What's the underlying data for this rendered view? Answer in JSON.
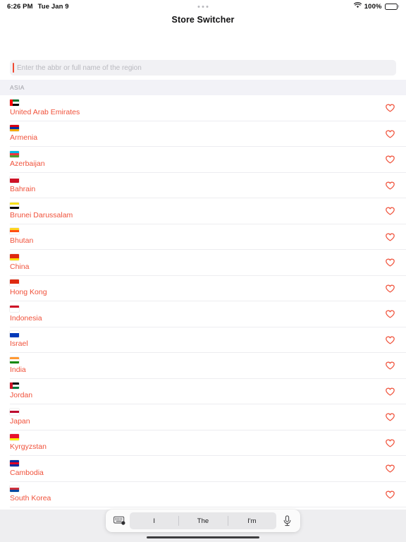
{
  "status_bar": {
    "time": "6:26 PM",
    "date": "Tue Jan 9",
    "battery_percent": "100%",
    "wifi_icon": "wifi-icon",
    "battery_icon": "battery-full-icon"
  },
  "nav": {
    "title": "Store Switcher",
    "multitask_icon": "multitasking-dots-icon"
  },
  "search": {
    "placeholder": "Enter the abbr or full name of the region",
    "value": "",
    "caret_color": "#f04a33"
  },
  "list": {
    "section_title": "ASIA",
    "accent_color": "#f0513a",
    "favorite_icon": "heart-outline-icon",
    "rows": [
      {
        "flag": "🇦🇪",
        "colors": [
          "#00732f",
          "#ffffff",
          "#000000"
        ],
        "hoist": "#ff0000",
        "name": "United Arab Emirates"
      },
      {
        "flag": "🇦🇲",
        "colors": [
          "#d90012",
          "#0033a0",
          "#f2a800"
        ],
        "hoist": "",
        "name": "Armenia"
      },
      {
        "flag": "🇦🇿",
        "colors": [
          "#00b5e2",
          "#ef3340",
          "#509e2f"
        ],
        "hoist": "",
        "name": "Azerbaijan"
      },
      {
        "flag": "🇧🇭",
        "colors": [
          "#ffffff",
          "#ce1126",
          "#ce1126"
        ],
        "hoist": "",
        "name": "Bahrain"
      },
      {
        "flag": "🇧🇳",
        "colors": [
          "#f7e017",
          "#ffffff",
          "#000000"
        ],
        "hoist": "",
        "name": "Brunei Darussalam"
      },
      {
        "flag": "🇧🇹",
        "colors": [
          "#ffd520",
          "#ff4e12",
          "#ffffff"
        ],
        "hoist": "",
        "name": "Bhutan"
      },
      {
        "flag": "🇨🇳",
        "colors": [
          "#de2910",
          "#de2910",
          "#ffde00"
        ],
        "hoist": "",
        "name": "China"
      },
      {
        "flag": "🇭🇰",
        "colors": [
          "#de2910",
          "#de2910",
          "#ffffff"
        ],
        "hoist": "",
        "name": "Hong Kong"
      },
      {
        "flag": "🇮🇩",
        "colors": [
          "#ce1126",
          "#ffffff",
          "#ffffff"
        ],
        "hoist": "",
        "name": "Indonesia"
      },
      {
        "flag": "🇮🇱",
        "colors": [
          "#ffffff",
          "#0038b8",
          "#0038b8"
        ],
        "hoist": "",
        "name": "Israel"
      },
      {
        "flag": "🇮🇳",
        "colors": [
          "#ff9933",
          "#ffffff",
          "#138808"
        ],
        "hoist": "",
        "name": "India"
      },
      {
        "flag": "🇯🇴",
        "colors": [
          "#000000",
          "#ffffff",
          "#007a3d"
        ],
        "hoist": "#ce1126",
        "name": "Jordan"
      },
      {
        "flag": "🇯🇵",
        "colors": [
          "#ffffff",
          "#bc002d",
          "#ffffff"
        ],
        "hoist": "",
        "name": "Japan"
      },
      {
        "flag": "🇰🇬",
        "colors": [
          "#e8112d",
          "#e8112d",
          "#ffef00"
        ],
        "hoist": "",
        "name": "Kyrgyzstan"
      },
      {
        "flag": "🇰🇭",
        "colors": [
          "#032ea1",
          "#e00025",
          "#032ea1"
        ],
        "hoist": "",
        "name": "Cambodia"
      },
      {
        "flag": "🇰🇷",
        "colors": [
          "#ffffff",
          "#cd2e3a",
          "#0047a0"
        ],
        "hoist": "",
        "name": "South Korea"
      },
      {
        "flag": "🇰🇼",
        "colors": [
          "#007a3d",
          "#ffffff",
          "#ce1126"
        ],
        "hoist": "#000000",
        "name": ""
      }
    ]
  },
  "keyboard_bar": {
    "keyboard_icon": "keyboard-dismiss-icon",
    "mic_icon": "microphone-icon",
    "predictions": [
      "I",
      "The",
      "I'm"
    ],
    "home_indicator": "home-indicator"
  }
}
